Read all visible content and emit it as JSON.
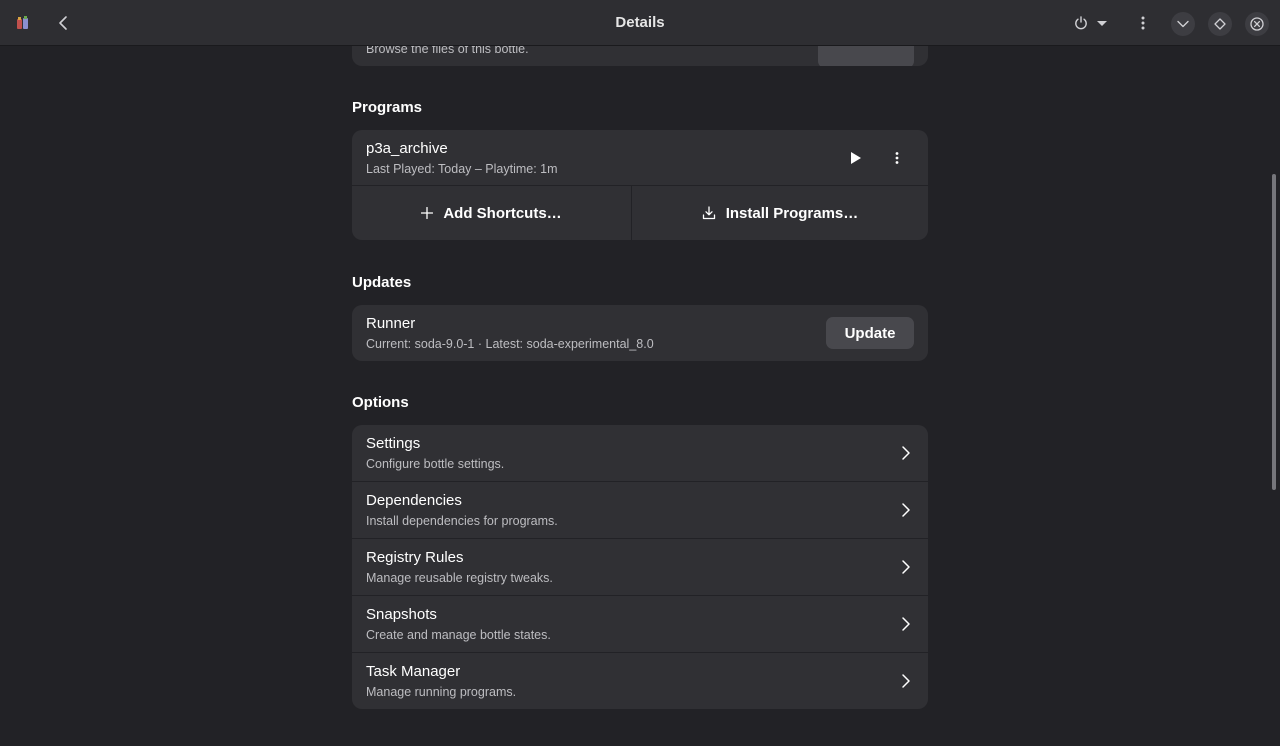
{
  "header": {
    "title": "Details",
    "icons": {
      "app": "bottles-app-icon",
      "back": "chevron-left-icon",
      "power": "power-icon",
      "power_dropdown": "triangle-down-icon",
      "menu": "more-vertical-icon",
      "minimize": "chevron-down-icon",
      "maximize": "diamond-icon",
      "close": "close-icon"
    }
  },
  "browse_files": {
    "subtitle": "Browse the files of this bottle."
  },
  "programs": {
    "heading": "Programs",
    "items": [
      {
        "title": "p3a_archive",
        "subtitle": "Last Played: Today – Playtime: 1m"
      }
    ],
    "add_shortcuts_label": "Add Shortcuts…",
    "install_programs_label": "Install Programs…"
  },
  "updates": {
    "heading": "Updates",
    "runner_title": "Runner",
    "runner_subtitle": "Current: soda-9.0-1 · Latest: soda-experimental_8.0",
    "update_label": "Update"
  },
  "options": {
    "heading": "Options",
    "items": [
      {
        "title": "Settings",
        "subtitle": "Configure bottle settings."
      },
      {
        "title": "Dependencies",
        "subtitle": "Install dependencies for programs."
      },
      {
        "title": "Registry Rules",
        "subtitle": "Manage reusable registry tweaks."
      },
      {
        "title": "Snapshots",
        "subtitle": "Create and manage bottle states."
      },
      {
        "title": "Task Manager",
        "subtitle": "Manage running programs."
      }
    ]
  },
  "colors": {
    "window_bg": "#222226",
    "card_bg": "#303034",
    "header_bg": "#2e2e32",
    "button_bg": "#48484d"
  }
}
